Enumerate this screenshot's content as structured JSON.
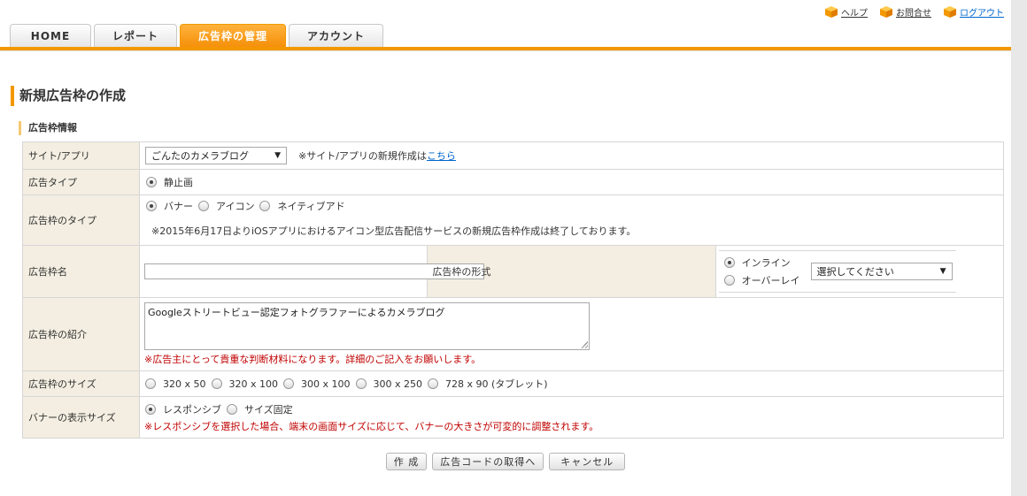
{
  "header": {
    "links": [
      {
        "label": "ヘルプ",
        "icon": "box-icon"
      },
      {
        "label": "お問合せ",
        "icon": "box-icon"
      },
      {
        "label": "ログアウト",
        "icon": "box-icon"
      }
    ]
  },
  "tabs": [
    {
      "label": "HOME"
    },
    {
      "label": "レポート"
    },
    {
      "label": "広告枠の管理",
      "active": true
    },
    {
      "label": "アカウント"
    }
  ],
  "page": {
    "title": "新規広告枠の作成",
    "section_title": "広告枠情報"
  },
  "form": {
    "site": {
      "label": "サイト/アプリ",
      "selected": "ごんたのカメラブログ",
      "note_prefix": "※サイト/アプリの新規作成は",
      "note_link": "こちら"
    },
    "ad_type": {
      "label": "広告タイプ",
      "options": [
        "静止画"
      ],
      "checked": 0
    },
    "slot_type": {
      "label": "広告枠のタイプ",
      "options": [
        "バナー",
        "アイコン",
        "ネイティブアド"
      ],
      "checked": 0,
      "note": "※2015年6月17日よりiOSアプリにおけるアイコン型広告配信サービスの新規広告枠作成は終了しております。"
    },
    "slot_name": {
      "label": "広告枠名",
      "value": ""
    },
    "slot_format": {
      "label": "広告枠の形式",
      "options": [
        "インライン",
        "オーバーレイ"
      ],
      "checked": 0,
      "select_placeholder": "選択してください"
    },
    "description": {
      "label": "広告枠の紹介",
      "value": "Googleストリートビュー認定フォトグラファーによるカメラブログ",
      "note": "※広告主にとって貴重な判断材料になります。詳細のご記入をお願いします。"
    },
    "slot_size": {
      "label": "広告枠のサイズ",
      "options": [
        "320 x 50",
        "320 x 100",
        "300 x 100",
        "300 x 250",
        "728 x 90 (タブレット)"
      ]
    },
    "banner_display": {
      "label": "バナーの表示サイズ",
      "options": [
        "レスポンシブ",
        "サイズ固定"
      ],
      "checked": 0,
      "note": "※レスポンシブを選択した場合、端末の画面サイズに応じて、バナーの大きさが可変的に調整されます。"
    }
  },
  "buttons": {
    "create": "作 成",
    "get_code": "広告コードの取得へ",
    "cancel": "キャンセル"
  },
  "colors": {
    "accent": "#f39800",
    "label_bg": "#f3eee1",
    "link": "#0066cc",
    "warning": "#c00000"
  }
}
